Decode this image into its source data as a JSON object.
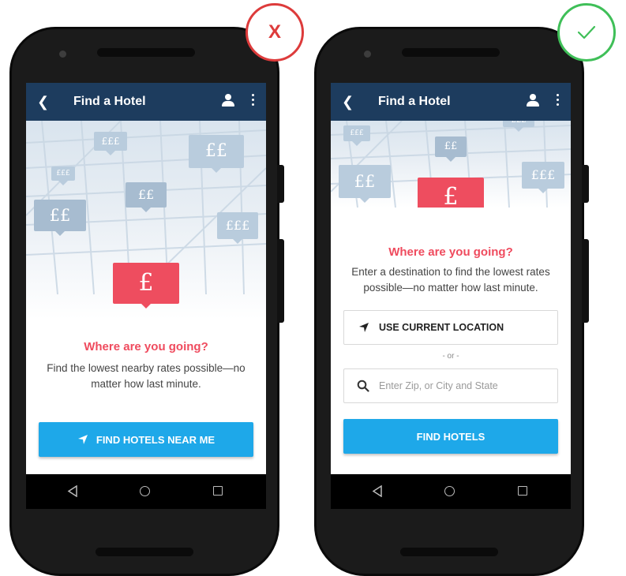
{
  "left_screen": {
    "app_title": "Find a Hotel",
    "prices": [
      "£££",
      "££",
      "£££",
      "££",
      "££",
      "£££",
      "£"
    ],
    "heading": "Where are you going?",
    "description": "Find the lowest nearby rates possible—no matter how last minute.",
    "primary_button": "FIND HOTELS NEAR ME"
  },
  "right_screen": {
    "app_title": "Find a Hotel",
    "prices": [
      "£££",
      "£££",
      "££",
      "££",
      "£££",
      "£"
    ],
    "heading": "Where are you going?",
    "description": "Enter a destination to find the lowest rates possible—no matter how last minute.",
    "location_button": "USE CURRENT LOCATION",
    "or_text": "- or -",
    "search_placeholder": "Enter Zip, or City and State",
    "primary_button": "FIND HOTELS"
  },
  "verdicts": {
    "bad": "X",
    "good": "check-icon"
  },
  "colors": {
    "app_bar": "#1d3c5e",
    "accent_red": "#ee4d5f",
    "button_blue": "#1ea8e9",
    "bad_verdict": "#dd3b3b",
    "good_verdict": "#3fbf58"
  }
}
